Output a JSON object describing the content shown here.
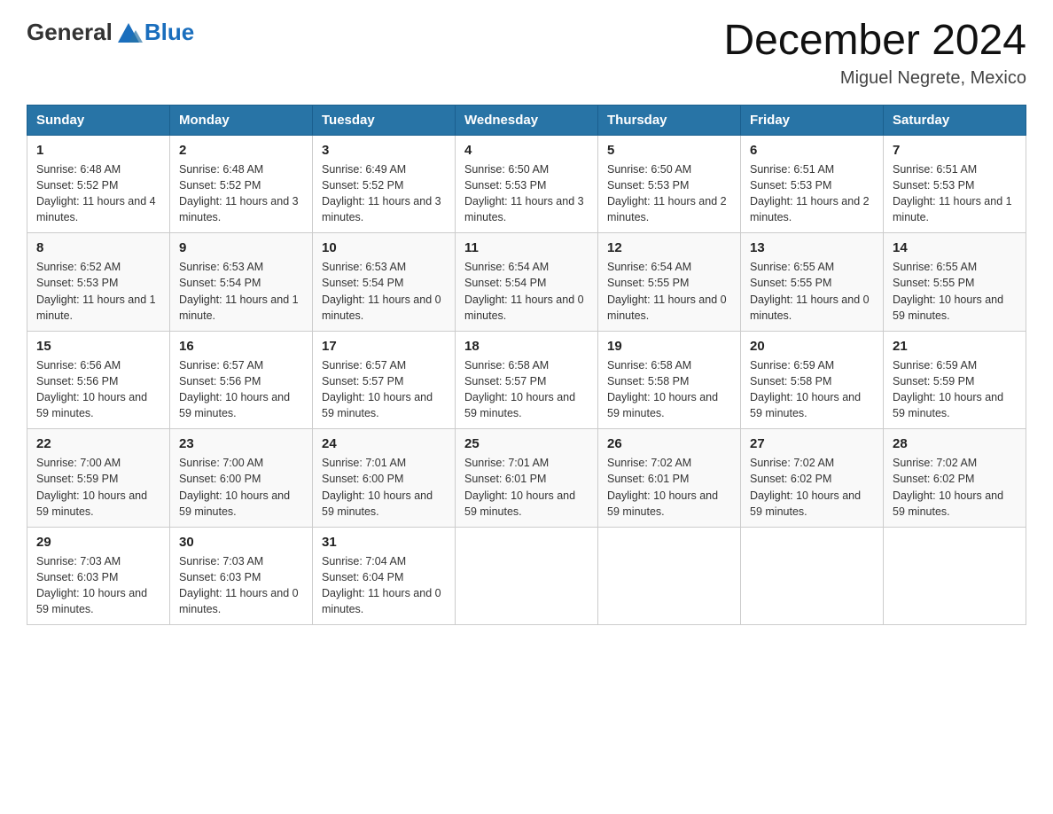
{
  "header": {
    "logo_general": "General",
    "logo_blue": "Blue",
    "title": "December 2024",
    "subtitle": "Miguel Negrete, Mexico"
  },
  "weekdays": [
    "Sunday",
    "Monday",
    "Tuesday",
    "Wednesday",
    "Thursday",
    "Friday",
    "Saturday"
  ],
  "weeks": [
    [
      {
        "day": "1",
        "sunrise": "6:48 AM",
        "sunset": "5:52 PM",
        "daylight": "11 hours and 4 minutes."
      },
      {
        "day": "2",
        "sunrise": "6:48 AM",
        "sunset": "5:52 PM",
        "daylight": "11 hours and 3 minutes."
      },
      {
        "day": "3",
        "sunrise": "6:49 AM",
        "sunset": "5:52 PM",
        "daylight": "11 hours and 3 minutes."
      },
      {
        "day": "4",
        "sunrise": "6:50 AM",
        "sunset": "5:53 PM",
        "daylight": "11 hours and 3 minutes."
      },
      {
        "day": "5",
        "sunrise": "6:50 AM",
        "sunset": "5:53 PM",
        "daylight": "11 hours and 2 minutes."
      },
      {
        "day": "6",
        "sunrise": "6:51 AM",
        "sunset": "5:53 PM",
        "daylight": "11 hours and 2 minutes."
      },
      {
        "day": "7",
        "sunrise": "6:51 AM",
        "sunset": "5:53 PM",
        "daylight": "11 hours and 1 minute."
      }
    ],
    [
      {
        "day": "8",
        "sunrise": "6:52 AM",
        "sunset": "5:53 PM",
        "daylight": "11 hours and 1 minute."
      },
      {
        "day": "9",
        "sunrise": "6:53 AM",
        "sunset": "5:54 PM",
        "daylight": "11 hours and 1 minute."
      },
      {
        "day": "10",
        "sunrise": "6:53 AM",
        "sunset": "5:54 PM",
        "daylight": "11 hours and 0 minutes."
      },
      {
        "day": "11",
        "sunrise": "6:54 AM",
        "sunset": "5:54 PM",
        "daylight": "11 hours and 0 minutes."
      },
      {
        "day": "12",
        "sunrise": "6:54 AM",
        "sunset": "5:55 PM",
        "daylight": "11 hours and 0 minutes."
      },
      {
        "day": "13",
        "sunrise": "6:55 AM",
        "sunset": "5:55 PM",
        "daylight": "11 hours and 0 minutes."
      },
      {
        "day": "14",
        "sunrise": "6:55 AM",
        "sunset": "5:55 PM",
        "daylight": "10 hours and 59 minutes."
      }
    ],
    [
      {
        "day": "15",
        "sunrise": "6:56 AM",
        "sunset": "5:56 PM",
        "daylight": "10 hours and 59 minutes."
      },
      {
        "day": "16",
        "sunrise": "6:57 AM",
        "sunset": "5:56 PM",
        "daylight": "10 hours and 59 minutes."
      },
      {
        "day": "17",
        "sunrise": "6:57 AM",
        "sunset": "5:57 PM",
        "daylight": "10 hours and 59 minutes."
      },
      {
        "day": "18",
        "sunrise": "6:58 AM",
        "sunset": "5:57 PM",
        "daylight": "10 hours and 59 minutes."
      },
      {
        "day": "19",
        "sunrise": "6:58 AM",
        "sunset": "5:58 PM",
        "daylight": "10 hours and 59 minutes."
      },
      {
        "day": "20",
        "sunrise": "6:59 AM",
        "sunset": "5:58 PM",
        "daylight": "10 hours and 59 minutes."
      },
      {
        "day": "21",
        "sunrise": "6:59 AM",
        "sunset": "5:59 PM",
        "daylight": "10 hours and 59 minutes."
      }
    ],
    [
      {
        "day": "22",
        "sunrise": "7:00 AM",
        "sunset": "5:59 PM",
        "daylight": "10 hours and 59 minutes."
      },
      {
        "day": "23",
        "sunrise": "7:00 AM",
        "sunset": "6:00 PM",
        "daylight": "10 hours and 59 minutes."
      },
      {
        "day": "24",
        "sunrise": "7:01 AM",
        "sunset": "6:00 PM",
        "daylight": "10 hours and 59 minutes."
      },
      {
        "day": "25",
        "sunrise": "7:01 AM",
        "sunset": "6:01 PM",
        "daylight": "10 hours and 59 minutes."
      },
      {
        "day": "26",
        "sunrise": "7:02 AM",
        "sunset": "6:01 PM",
        "daylight": "10 hours and 59 minutes."
      },
      {
        "day": "27",
        "sunrise": "7:02 AM",
        "sunset": "6:02 PM",
        "daylight": "10 hours and 59 minutes."
      },
      {
        "day": "28",
        "sunrise": "7:02 AM",
        "sunset": "6:02 PM",
        "daylight": "10 hours and 59 minutes."
      }
    ],
    [
      {
        "day": "29",
        "sunrise": "7:03 AM",
        "sunset": "6:03 PM",
        "daylight": "10 hours and 59 minutes."
      },
      {
        "day": "30",
        "sunrise": "7:03 AM",
        "sunset": "6:03 PM",
        "daylight": "11 hours and 0 minutes."
      },
      {
        "day": "31",
        "sunrise": "7:04 AM",
        "sunset": "6:04 PM",
        "daylight": "11 hours and 0 minutes."
      },
      null,
      null,
      null,
      null
    ]
  ],
  "labels": {
    "sunrise": "Sunrise:",
    "sunset": "Sunset:",
    "daylight": "Daylight:"
  }
}
